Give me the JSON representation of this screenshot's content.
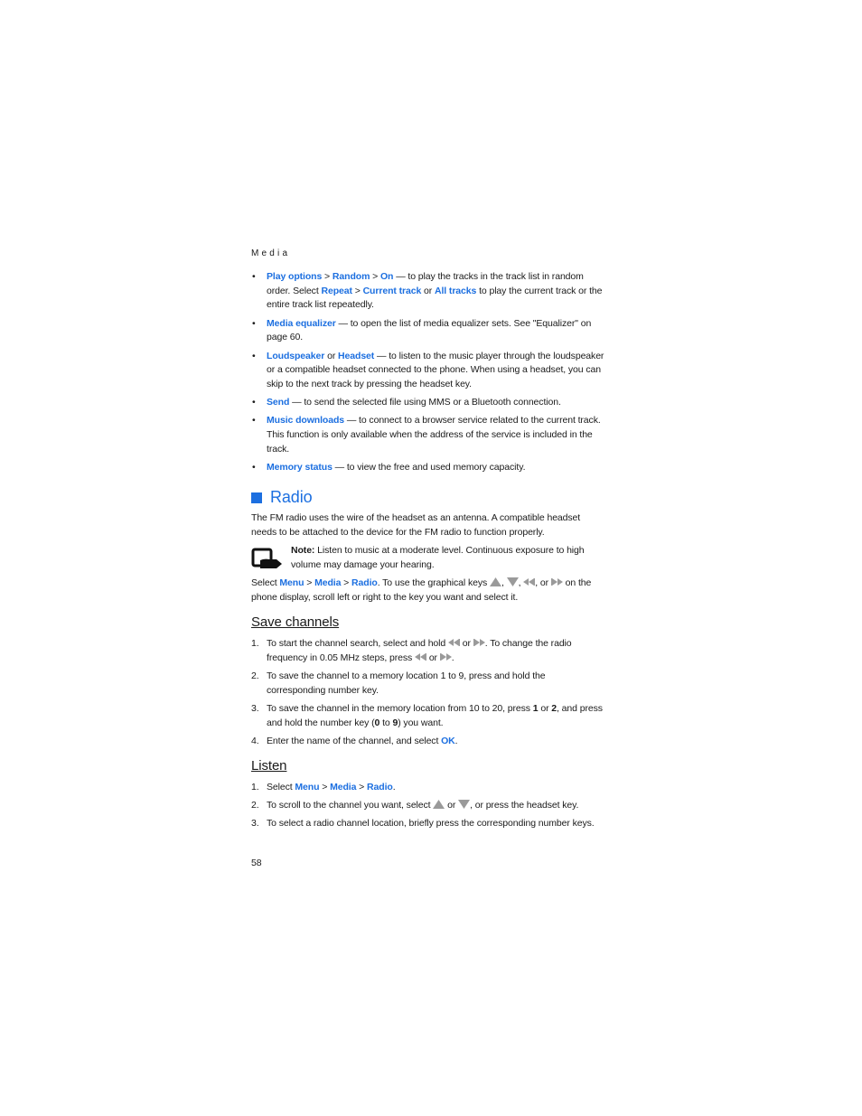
{
  "header": {
    "section": "Media"
  },
  "bullets": [
    {
      "parts": [
        {
          "t": "Play options",
          "b": true
        },
        {
          "t": " > "
        },
        {
          "t": "Random",
          "b": true
        },
        {
          "t": " > "
        },
        {
          "t": "On",
          "b": true
        },
        {
          "t": " — to play the tracks in the track list in random order. Select "
        },
        {
          "t": "Repeat",
          "b": true
        },
        {
          "t": " > "
        },
        {
          "t": "Current track",
          "b": true
        },
        {
          "t": " or "
        },
        {
          "t": "All tracks",
          "b": true
        },
        {
          "t": " to play the current track or the entire track list repeatedly."
        }
      ]
    },
    {
      "parts": [
        {
          "t": "Media equalizer",
          "b": true
        },
        {
          "t": " — to open the list of media equalizer sets. See \"Equalizer\" on page 60."
        }
      ]
    },
    {
      "parts": [
        {
          "t": "Loudspeaker",
          "b": true
        },
        {
          "t": " or "
        },
        {
          "t": "Headset",
          "b": true
        },
        {
          "t": " — to listen to the music player through the loudspeaker or a compatible headset connected to the phone. When using a headset, you can skip to the next track by pressing the headset key."
        }
      ]
    },
    {
      "parts": [
        {
          "t": "Send",
          "b": true
        },
        {
          "t": " — to send the selected file using MMS or a Bluetooth connection."
        }
      ]
    },
    {
      "parts": [
        {
          "t": "Music downloads",
          "b": true
        },
        {
          "t": " — to connect to a browser service related to the current track. This function is only available when the address of the service is included in the track."
        }
      ]
    },
    {
      "parts": [
        {
          "t": "Memory status",
          "b": true
        },
        {
          "t": " — to view the free and used memory capacity."
        }
      ]
    }
  ],
  "radio": {
    "title": "Radio",
    "intro": "The FM radio uses the wire of the headset as an antenna. A compatible headset needs to be attached to the device for the FM radio to function properly.",
    "note_label": "Note:",
    "note_text": " Listen to music at a moderate level. Continuous exposure to high volume may damage your hearing.",
    "select_parts": [
      {
        "t": "Select "
      },
      {
        "t": "Menu",
        "b": true
      },
      {
        "t": " > "
      },
      {
        "t": "Media",
        "b": true
      },
      {
        "t": " > "
      },
      {
        "t": "Radio",
        "b": true
      },
      {
        "t": ". To use the graphical keys "
      },
      {
        "k": "up"
      },
      {
        "t": ", "
      },
      {
        "k": "down"
      },
      {
        "t": ", "
      },
      {
        "k": "rew"
      },
      {
        "t": ", or "
      },
      {
        "k": "ff"
      },
      {
        "t": " on the phone display, scroll left or right to the key you want and select it."
      }
    ]
  },
  "save_channels": {
    "title": "Save channels",
    "steps": [
      {
        "num": "1.",
        "parts": [
          {
            "t": "To start the channel search, select and hold "
          },
          {
            "k": "rew"
          },
          {
            "t": " or "
          },
          {
            "k": "ff"
          },
          {
            "t": ". To change the radio frequency in 0.05 MHz steps, press "
          },
          {
            "k": "rew"
          },
          {
            "t": " or "
          },
          {
            "k": "ff"
          },
          {
            "t": "."
          }
        ]
      },
      {
        "num": "2.",
        "parts": [
          {
            "t": "To save the channel to a memory location 1 to 9, press and hold the corresponding number key."
          }
        ]
      },
      {
        "num": "3.",
        "parts": [
          {
            "t": "To save the channel in the memory location from 10 to 20, press "
          },
          {
            "t": "1",
            "k2": true
          },
          {
            "t": " or "
          },
          {
            "t": "2",
            "k2": true
          },
          {
            "t": ", and press and hold the number key ("
          },
          {
            "t": "0",
            "k2": true
          },
          {
            "t": " to "
          },
          {
            "t": "9",
            "k2": true
          },
          {
            "t": ") you want."
          }
        ]
      },
      {
        "num": "4.",
        "parts": [
          {
            "t": "Enter the name of the channel, and select "
          },
          {
            "t": "OK",
            "b": true
          },
          {
            "t": "."
          }
        ]
      }
    ]
  },
  "listen": {
    "title": "Listen",
    "steps": [
      {
        "num": "1.",
        "parts": [
          {
            "t": "Select "
          },
          {
            "t": "Menu",
            "b": true
          },
          {
            "t": " > "
          },
          {
            "t": "Media",
            "b": true
          },
          {
            "t": " > "
          },
          {
            "t": "Radio",
            "b": true
          },
          {
            "t": "."
          }
        ]
      },
      {
        "num": "2.",
        "parts": [
          {
            "t": "To scroll to the channel you want, select "
          },
          {
            "k": "up"
          },
          {
            "t": " or "
          },
          {
            "k": "down"
          },
          {
            "t": ", or press the headset key."
          }
        ]
      },
      {
        "num": "3.",
        "parts": [
          {
            "t": "To select a radio channel location, briefly press the corresponding number keys."
          }
        ]
      }
    ]
  },
  "footer": {
    "page_number": "58"
  },
  "colors": {
    "link": "#1c6fe0",
    "text": "#1a1a1a",
    "key_icon": "#9a9a9a"
  }
}
